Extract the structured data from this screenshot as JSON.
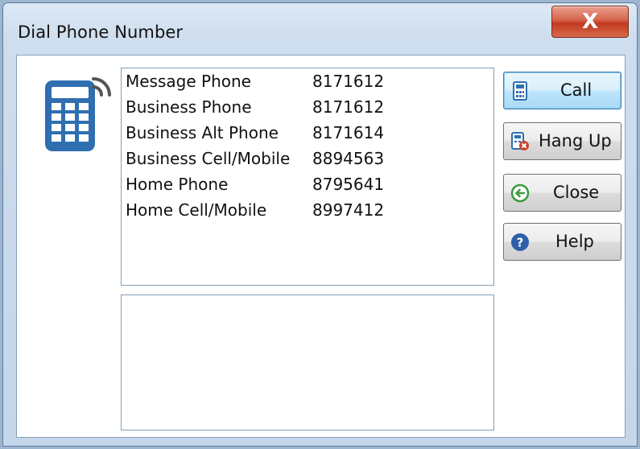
{
  "window": {
    "title": "Dial Phone Number",
    "close_glyph": "X"
  },
  "icons": {
    "app": "mobile-phone-signal-icon",
    "call": "calculator-phone-icon",
    "hangup": "phone-cancel-icon",
    "close": "back-arrow-circle-icon",
    "help": "help-circle-icon"
  },
  "phones": [
    {
      "label": "Message Phone",
      "number": "8171612"
    },
    {
      "label": "Business Phone",
      "number": "8171612"
    },
    {
      "label": "Business Alt Phone",
      "number": "8171614"
    },
    {
      "label": "Business Cell/Mobile",
      "number": "8894563"
    },
    {
      "label": "Home Phone",
      "number": "8795641"
    },
    {
      "label": "Home Cell/Mobile",
      "number": "8997412"
    }
  ],
  "notes": "",
  "buttons": {
    "call": "Call",
    "hangup": "Hang Up",
    "close": "Close",
    "help": "Help"
  },
  "colors": {
    "accent": "#2f6fb0",
    "close_red": "#c9432a",
    "green": "#3a9a3a"
  }
}
